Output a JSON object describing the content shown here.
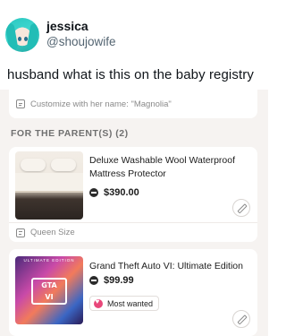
{
  "tweet": {
    "display_name": "jessica",
    "handle": "@shoujowife",
    "text": "husband what is this on the baby registry"
  },
  "registry": {
    "top_note": "Customize with her name: \"Magnolia\"",
    "section_label": "FOR THE PARENT(S) (2)",
    "items": [
      {
        "title": "Deluxe Washable Wool Waterproof Mattress Protector",
        "price": "$390.00",
        "note": "Queen Size"
      },
      {
        "title": "Grand Theft Auto VI: Ultimate Edition",
        "price": "$99.99",
        "badge": "Most wanted"
      }
    ]
  }
}
